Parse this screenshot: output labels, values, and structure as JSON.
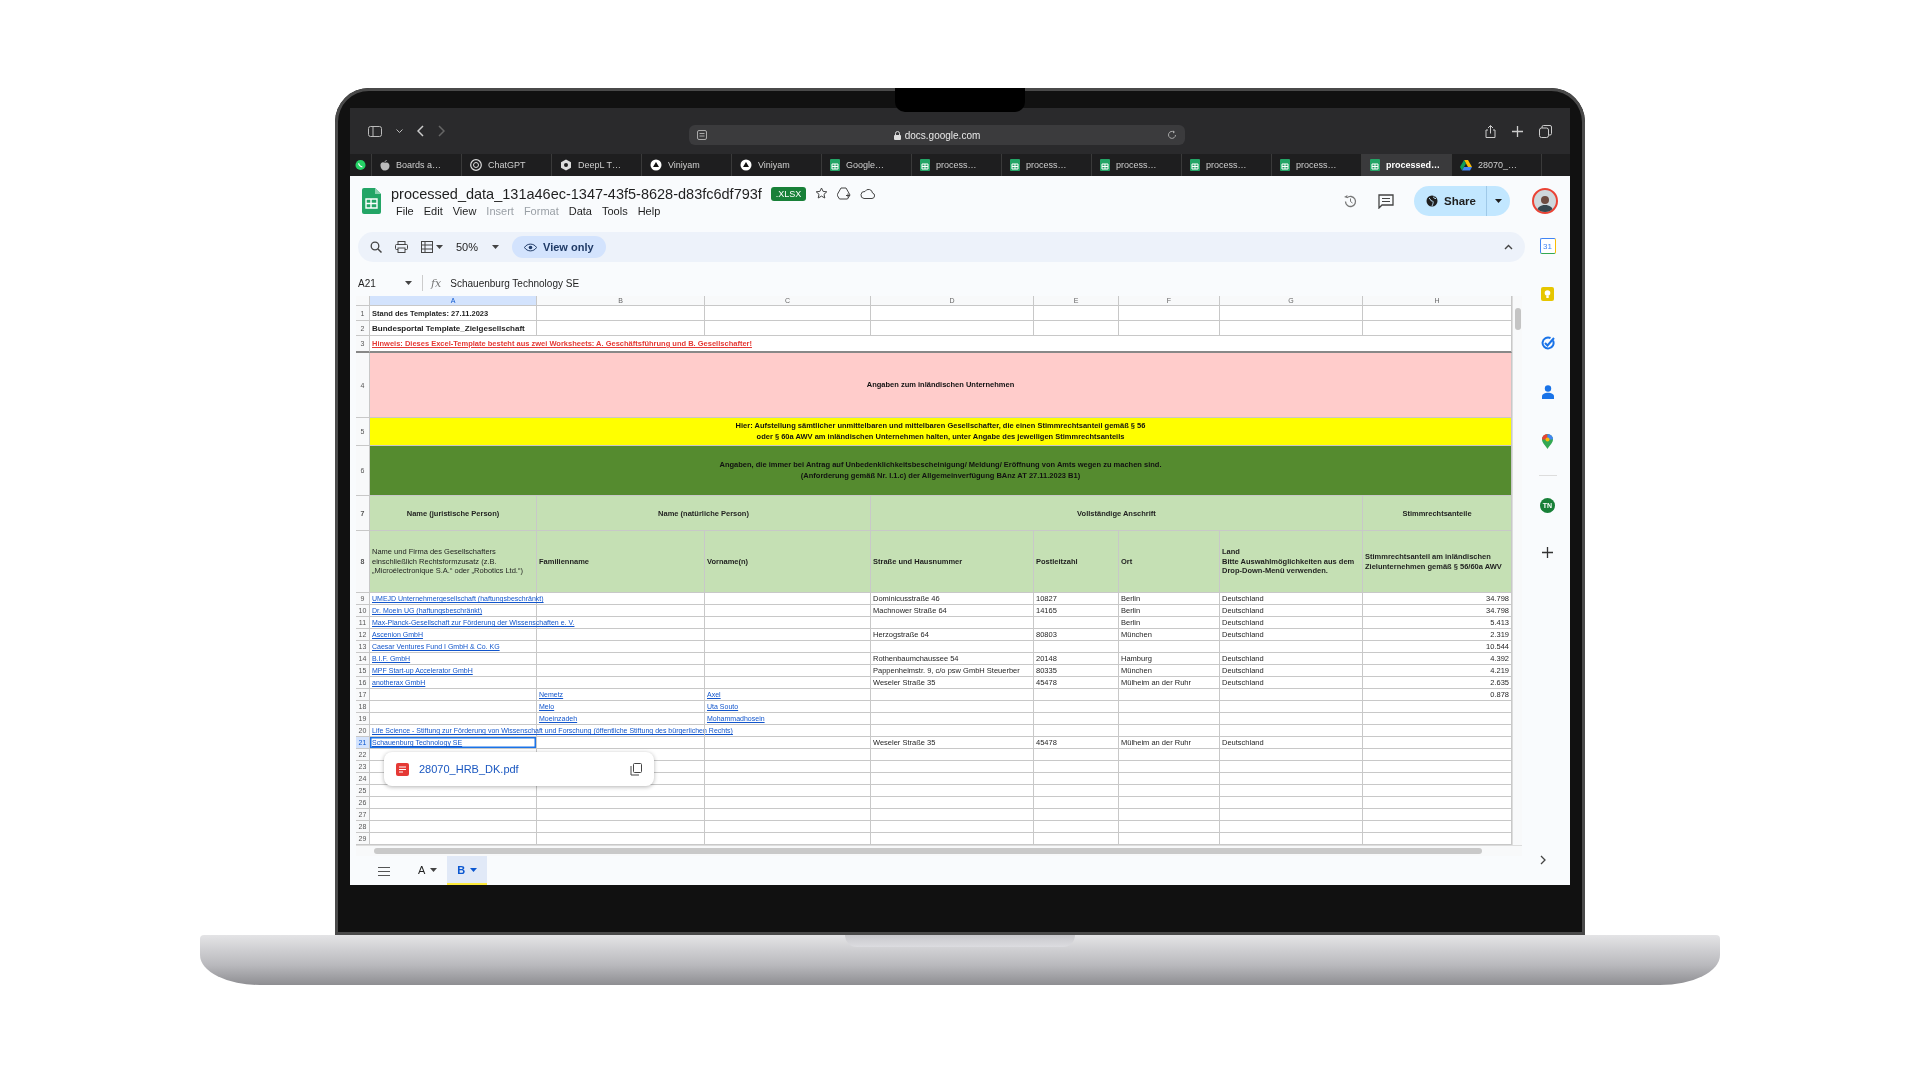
{
  "browser": {
    "url": "docs.google.com",
    "tabs": [
      {
        "kind": "whatsapp",
        "selected": false
      },
      {
        "kind": "apple",
        "label": "Boards a…",
        "selected": false
      },
      {
        "kind": "chatgpt",
        "label": "ChatGPT",
        "selected": false
      },
      {
        "kind": "deepl",
        "label": "DeepL T…",
        "selected": false
      },
      {
        "kind": "viniyam",
        "label": "Viniyam",
        "selected": false
      },
      {
        "kind": "viniyam",
        "label": "Viniyam",
        "selected": false
      },
      {
        "kind": "sheets",
        "label": "Google…",
        "selected": false
      },
      {
        "kind": "sheets",
        "label": "process…",
        "selected": false
      },
      {
        "kind": "sheets",
        "label": "process…",
        "selected": false
      },
      {
        "kind": "sheets",
        "label": "process…",
        "selected": false
      },
      {
        "kind": "sheets",
        "label": "process…",
        "selected": false
      },
      {
        "kind": "sheets",
        "label": "process…",
        "selected": false
      },
      {
        "kind": "sheets",
        "label": "processed…",
        "selected": true
      },
      {
        "kind": "drive",
        "label": "28070_…",
        "selected": false
      }
    ]
  },
  "doc": {
    "title": "processed_data_131a46ec-1347-43f5-8628-d83fc6df793f",
    "badge": ".XLSX",
    "share": "Share",
    "zoom": "50%",
    "view_only": "View only",
    "cell_ref": "A21",
    "function_label": "fx",
    "formula": "Schauenburg Technology SE",
    "menu": [
      {
        "label": "File",
        "disabled": false
      },
      {
        "label": "Edit",
        "disabled": false
      },
      {
        "label": "View",
        "disabled": false
      },
      {
        "label": "Insert",
        "disabled": true
      },
      {
        "label": "Format",
        "disabled": true
      },
      {
        "label": "Data",
        "disabled": false
      },
      {
        "label": "Tools",
        "disabled": false
      },
      {
        "label": "Help",
        "disabled": false
      }
    ]
  },
  "sheet": {
    "columns": [
      {
        "label": "A",
        "selected": true
      },
      {
        "label": "B",
        "selected": false
      },
      {
        "label": "C",
        "selected": false
      },
      {
        "label": "D",
        "selected": false
      },
      {
        "label": "E",
        "selected": false
      },
      {
        "label": "F",
        "selected": false
      },
      {
        "label": "G",
        "selected": false
      },
      {
        "label": "H",
        "selected": false
      }
    ],
    "rows": [
      {
        "n": "1",
        "kind": "plain",
        "text": "Stand des Templates: 27.11.2023",
        "selected": false
      },
      {
        "n": "2",
        "kind": "title",
        "text": "Bundesportal Template_Zielgesellschaft",
        "selected": false
      },
      {
        "n": "3",
        "kind": "warning",
        "text": "Hinweis: Dieses Excel-Template besteht aus zwei Worksheets: A. Geschäftsführung und B. Gesellschafter!",
        "selected": false
      },
      {
        "n": "4",
        "kind": "section",
        "text": "Angaben zum inländischen Unternehmen",
        "selected": false
      },
      {
        "n": "5",
        "kind": "note",
        "text": "Hier: Aufstellung sämtlicher unmittelbaren und mittelbaren Gesellschafter, die einen Stimmrechtsanteil gemäß § 56\noder § 60a AWV am inländischen Unternehmen halten, unter Angabe des jeweiligen Stimmrechtsanteils",
        "selected": false
      },
      {
        "n": "6",
        "kind": "notice",
        "text": "Angaben, die immer bei Antrag auf Unbedenklichkeitsbescheinigung/ Meldung/ Eröffnung von Amts wegen zu machen sind.\n(Anforderung gemäß Nr. I.1.c) der Allgemeinverfügung BAnz AT 27.11.2023 B1)",
        "selected": false
      },
      {
        "n": "7",
        "kind": "group",
        "selected": false,
        "cells": [
          "Name (juristische Person)",
          "Name (natürliche Person)",
          "Vollständige Anschrift",
          "Stimmrechtsanteile"
        ]
      },
      {
        "n": "8",
        "kind": "header",
        "selected": false,
        "cells": [
          "Name und Firma des Gesellschafters einschließlich Rechtsformzusatz  (z.B. „Microélectronique S.A.“ oder „Robotics Ltd.“)",
          "Familienname",
          "Vorname(n)",
          "Straße und Hausnummer",
          "Postleitzahl",
          "Ort",
          "Land\nBitte Auswahlmöglichkeiten aus dem Drop-Down-Menü verwenden.",
          "Stimmrechtsanteil am inländischen Zielunternehmen gemäß § 56/60a AWV"
        ]
      },
      {
        "n": "9",
        "kind": "data",
        "selected": false,
        "cells": {
          "A": {
            "kind": "link",
            "text": "UMEJD Unternehmergesellschaft (haftungsbeschränkt)"
          },
          "D": {
            "kind": "text",
            "text": "Dominicusstraße 46"
          },
          "E": {
            "kind": "text",
            "text": "10827"
          },
          "F": {
            "kind": "text",
            "text": "Berlin"
          },
          "G": {
            "kind": "text",
            "text": "Deutschland"
          },
          "H": {
            "kind": "number",
            "text": "34.798"
          }
        }
      },
      {
        "n": "10",
        "kind": "data",
        "selected": false,
        "cells": {
          "A": {
            "kind": "link",
            "text": "Dr. Moein UG (haftungsbeschränkt)"
          },
          "D": {
            "kind": "text",
            "text": "Machnower Straße 64"
          },
          "E": {
            "kind": "text",
            "text": "14165"
          },
          "F": {
            "kind": "text",
            "text": "Berlin"
          },
          "G": {
            "kind": "text",
            "text": "Deutschland"
          },
          "H": {
            "kind": "number",
            "text": "34.798"
          }
        }
      },
      {
        "n": "11",
        "kind": "data",
        "selected": false,
        "cells": {
          "A": {
            "kind": "link",
            "text": "Max-Planck-Gesellschaft zur Förderung der Wissenschaften e. V."
          },
          "F": {
            "kind": "text",
            "text": "Berlin"
          },
          "G": {
            "kind": "text",
            "text": "Deutschland"
          },
          "H": {
            "kind": "number",
            "text": "5.413"
          }
        }
      },
      {
        "n": "12",
        "kind": "data",
        "selected": false,
        "cells": {
          "A": {
            "kind": "link",
            "text": "Ascenion GmbH"
          },
          "D": {
            "kind": "text",
            "text": "Herzogstraße 64"
          },
          "E": {
            "kind": "text",
            "text": "80803"
          },
          "F": {
            "kind": "text",
            "text": "München"
          },
          "G": {
            "kind": "text",
            "text": "Deutschland"
          },
          "H": {
            "kind": "number",
            "text": "2.319"
          }
        }
      },
      {
        "n": "13",
        "kind": "data",
        "selected": false,
        "cells": {
          "A": {
            "kind": "link",
            "text": "Caesar Ventures Fund I GmbH & Co. KG"
          },
          "H": {
            "kind": "number",
            "text": "10.544"
          }
        }
      },
      {
        "n": "14",
        "kind": "data",
        "selected": false,
        "cells": {
          "A": {
            "kind": "link",
            "text": "B.I.F. GmbH"
          },
          "D": {
            "kind": "text",
            "text": "Rothenbaumchaussee 54"
          },
          "E": {
            "kind": "text",
            "text": "20148"
          },
          "F": {
            "kind": "text",
            "text": "Hamburg"
          },
          "G": {
            "kind": "text",
            "text": "Deutschland"
          },
          "H": {
            "kind": "number",
            "text": "4.392"
          }
        }
      },
      {
        "n": "15",
        "kind": "data",
        "selected": false,
        "cells": {
          "A": {
            "kind": "link",
            "text": "MPF Start-up Accelerator GmbH"
          },
          "D": {
            "kind": "text",
            "text": "Pappenheimstr. 9, c/o psw GmbH Steuerber"
          },
          "E": {
            "kind": "text",
            "text": "80335"
          },
          "F": {
            "kind": "text",
            "text": "München"
          },
          "G": {
            "kind": "text",
            "text": "Deutschland"
          },
          "H": {
            "kind": "number",
            "text": "4.219"
          }
        }
      },
      {
        "n": "16",
        "kind": "data",
        "selected": false,
        "cells": {
          "A": {
            "kind": "link",
            "text": "anotherax GmbH"
          },
          "D": {
            "kind": "text",
            "text": "Weseler Straße 35"
          },
          "E": {
            "kind": "text",
            "text": "45478"
          },
          "F": {
            "kind": "text",
            "text": "Mülheim an der Ruhr"
          },
          "G": {
            "kind": "text",
            "text": "Deutschland"
          },
          "H": {
            "kind": "number",
            "text": "2.635"
          }
        }
      },
      {
        "n": "17",
        "kind": "data",
        "selected": false,
        "cells": {
          "B": {
            "kind": "link",
            "text": "Nemetz"
          },
          "C": {
            "kind": "link",
            "text": "Axel"
          },
          "H": {
            "kind": "number",
            "text": "0.878"
          }
        }
      },
      {
        "n": "18",
        "kind": "data",
        "selected": false,
        "cells": {
          "B": {
            "kind": "link",
            "text": "Melo"
          },
          "C": {
            "kind": "link",
            "text": "Uta Souto"
          }
        }
      },
      {
        "n": "19",
        "kind": "data",
        "selected": false,
        "cells": {
          "B": {
            "kind": "link",
            "text": "Moeinzadeh"
          },
          "C": {
            "kind": "link",
            "text": "Mohammadhosein"
          }
        }
      },
      {
        "n": "20",
        "kind": "data",
        "selected": false,
        "cells": {
          "A": {
            "kind": "link",
            "text": "Life Science - Stiftung zur Förderung von Wissenschaft und Forschung (öffentliche Stiftung des bürgerlichen Rechts)"
          }
        }
      },
      {
        "n": "21",
        "kind": "data",
        "selected": true,
        "cells": {
          "A": {
            "kind": "link",
            "text": "Schauenburg Technology SE"
          },
          "D": {
            "kind": "text",
            "text": "Weseler Straße 35"
          },
          "E": {
            "kind": "text",
            "text": "45478"
          },
          "F": {
            "kind": "text",
            "text": "Mülheim an der Ruhr"
          },
          "G": {
            "kind": "text",
            "text": "Deutschland"
          }
        }
      },
      {
        "n": "22",
        "kind": "data",
        "selected": false
      },
      {
        "n": "23",
        "kind": "data",
        "selected": false
      },
      {
        "n": "24",
        "kind": "data",
        "selected": false
      },
      {
        "n": "25",
        "kind": "data",
        "selected": false
      },
      {
        "n": "26",
        "kind": "data",
        "selected": false
      },
      {
        "n": "27",
        "kind": "data",
        "selected": false
      },
      {
        "n": "28",
        "kind": "data",
        "selected": false
      },
      {
        "n": "29",
        "kind": "data",
        "selected": false
      }
    ]
  },
  "attachment": {
    "name": "28070_HRB_DK.pdf"
  },
  "sheet_tabs": [
    {
      "label": "A",
      "selected": false
    },
    {
      "label": "B",
      "selected": true,
      "color": "#ffeb3b"
    }
  ],
  "side_panel": [
    {
      "kind": "calendar",
      "label": "31"
    },
    {
      "kind": "keep"
    },
    {
      "kind": "tasks"
    },
    {
      "kind": "contacts"
    },
    {
      "kind": "maps"
    },
    {
      "kind": "account",
      "label": "TN"
    },
    {
      "kind": "add"
    }
  ]
}
